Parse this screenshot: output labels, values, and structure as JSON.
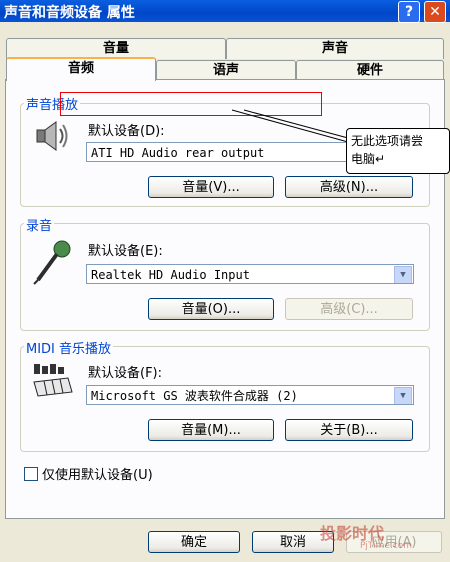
{
  "window": {
    "title": "声音和音频设备 属性",
    "help_label": "?",
    "close_label": "✕"
  },
  "tabs_row1": [
    {
      "label": "音量"
    },
    {
      "label": "声音"
    }
  ],
  "tabs_row2": [
    {
      "label": "音频",
      "active": true
    },
    {
      "label": "语声"
    },
    {
      "label": "硬件"
    }
  ],
  "playback": {
    "group_title": "声音播放",
    "icon": "speaker-icon",
    "default_label": "默认设备(D):",
    "device": "ATI HD Audio rear output",
    "volume_button": "音量(V)...",
    "advanced_button": "高级(N)..."
  },
  "recording": {
    "group_title": "录音",
    "icon": "microphone-icon",
    "default_label": "默认设备(E):",
    "device": "Realtek HD Audio Input",
    "volume_button": "音量(O)...",
    "advanced_button": "高级(C)..."
  },
  "midi": {
    "group_title": "MIDI 音乐播放",
    "icon": "midi-keyboard-icon",
    "default_label": "默认设备(F):",
    "device": "Microsoft GS 波表软件合成器 (2)",
    "volume_button": "音量(M)...",
    "about_button": "关于(B)..."
  },
  "only_default": {
    "label": "仅使用默认设备(U)",
    "checked": false
  },
  "annotation": {
    "text_line1": "无此选项请尝",
    "text_line2": "电脑↵"
  },
  "footer": {
    "ok_button": "确定",
    "cancel_button": "取消",
    "apply_button": "应用(A)"
  },
  "watermark": {
    "cn": "投影时代",
    "url": "PjTime.com"
  },
  "colors": {
    "title_bar": "#0046c8",
    "group_title": "#0046d5",
    "annotation_box": "#e00000"
  }
}
